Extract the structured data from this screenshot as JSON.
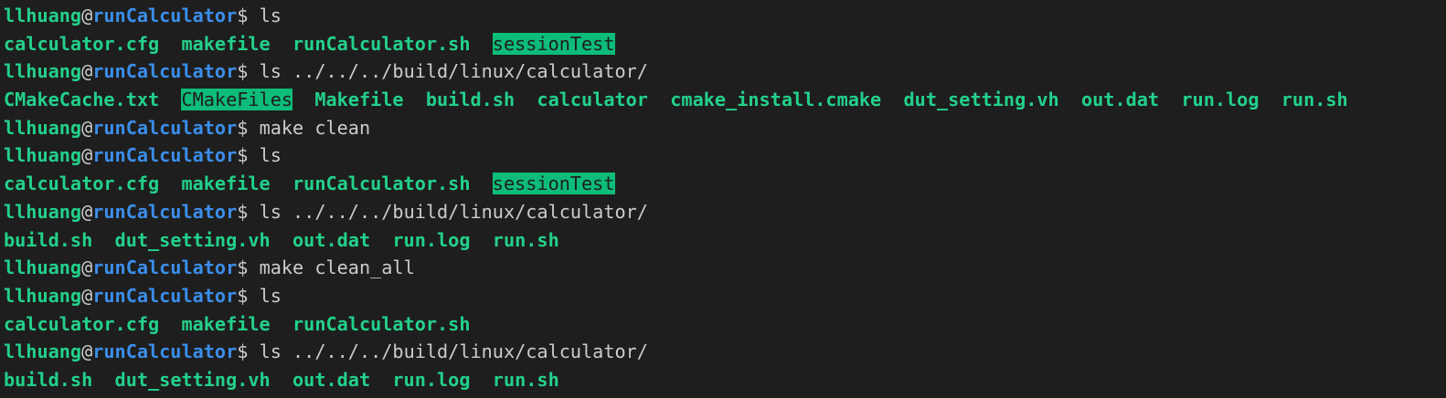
{
  "colors": {
    "background": "#1e1e1e",
    "user": "#23d18b",
    "host": "#3b8eea",
    "text": "#cccccc",
    "file": "#23d18b",
    "highlight_bg": "#0dbc79"
  },
  "prompt": {
    "user": "llhuang",
    "at": "@",
    "host": "runCalculator",
    "symbol": "$ "
  },
  "lines": [
    {
      "type": "prompt",
      "command": "ls"
    },
    {
      "type": "output",
      "items": [
        {
          "text": "calculator.cfg",
          "highlight": false
        },
        {
          "text": "makefile",
          "highlight": false
        },
        {
          "text": "runCalculator.sh",
          "highlight": false
        },
        {
          "text": "sessionTest",
          "highlight": true
        }
      ]
    },
    {
      "type": "prompt",
      "command": "ls ../../../build/linux/calculator/"
    },
    {
      "type": "output",
      "items": [
        {
          "text": "CMakeCache.txt",
          "highlight": false
        },
        {
          "text": "CMakeFiles",
          "highlight": true
        },
        {
          "text": "Makefile",
          "highlight": false
        },
        {
          "text": "build.sh",
          "highlight": false
        },
        {
          "text": "calculator",
          "highlight": false
        },
        {
          "text": "cmake_install.cmake",
          "highlight": false
        },
        {
          "text": "dut_setting.vh",
          "highlight": false
        },
        {
          "text": "out.dat",
          "highlight": false
        },
        {
          "text": "run.log",
          "highlight": false
        },
        {
          "text": "run.sh",
          "highlight": false
        }
      ]
    },
    {
      "type": "prompt",
      "command": "make clean"
    },
    {
      "type": "prompt",
      "command": "ls"
    },
    {
      "type": "output",
      "items": [
        {
          "text": "calculator.cfg",
          "highlight": false
        },
        {
          "text": "makefile",
          "highlight": false
        },
        {
          "text": "runCalculator.sh",
          "highlight": false
        },
        {
          "text": "sessionTest",
          "highlight": true
        }
      ]
    },
    {
      "type": "prompt",
      "command": "ls ../../../build/linux/calculator/"
    },
    {
      "type": "output",
      "items": [
        {
          "text": "build.sh",
          "highlight": false
        },
        {
          "text": "dut_setting.vh",
          "highlight": false
        },
        {
          "text": "out.dat",
          "highlight": false
        },
        {
          "text": "run.log",
          "highlight": false
        },
        {
          "text": "run.sh",
          "highlight": false
        }
      ]
    },
    {
      "type": "prompt",
      "command": "make clean_all"
    },
    {
      "type": "prompt",
      "command": "ls"
    },
    {
      "type": "output",
      "items": [
        {
          "text": "calculator.cfg",
          "highlight": false
        },
        {
          "text": "makefile",
          "highlight": false
        },
        {
          "text": "runCalculator.sh",
          "highlight": false
        }
      ]
    },
    {
      "type": "prompt",
      "command": "ls ../../../build/linux/calculator/"
    },
    {
      "type": "output",
      "items": [
        {
          "text": "build.sh",
          "highlight": false
        },
        {
          "text": "dut_setting.vh",
          "highlight": false
        },
        {
          "text": "out.dat",
          "highlight": false
        },
        {
          "text": "run.log",
          "highlight": false
        },
        {
          "text": "run.sh",
          "highlight": false
        }
      ]
    }
  ]
}
